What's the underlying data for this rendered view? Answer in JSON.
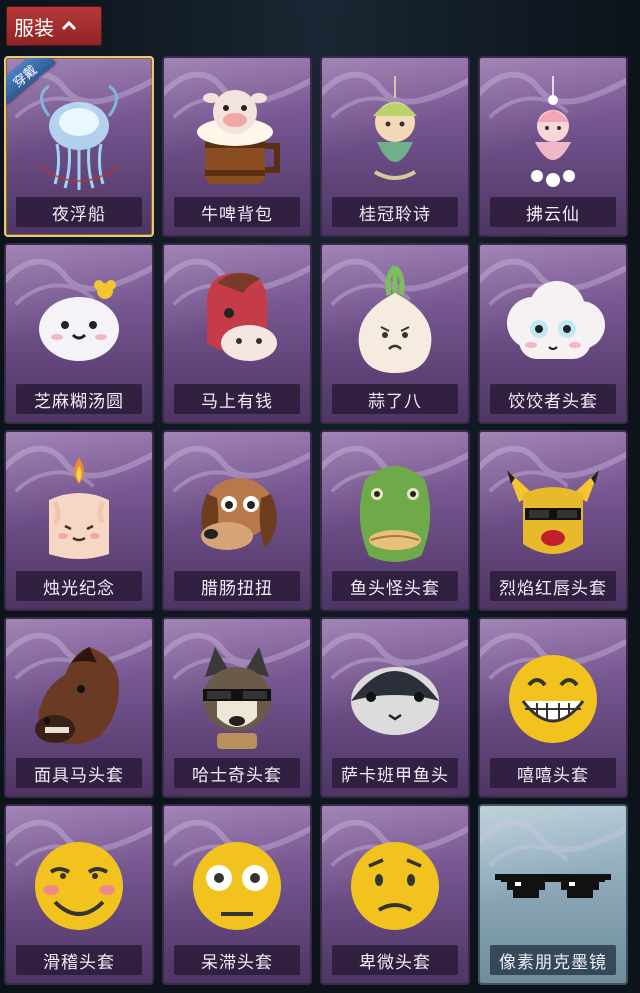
{
  "header": {
    "title": "服装",
    "icon": "chevron-up-icon"
  },
  "equipped_badge": "穿戴",
  "items": [
    {
      "name": "夜浮船",
      "theme": "purple",
      "equipped": true,
      "art": "jellyfish"
    },
    {
      "name": "牛啤背包",
      "theme": "purple",
      "equipped": false,
      "art": "cow-barrel"
    },
    {
      "name": "桂冠聆诗",
      "theme": "purple",
      "equipped": false,
      "art": "laurel-charm"
    },
    {
      "name": "拂云仙",
      "theme": "purple",
      "equipped": false,
      "art": "cloud-fairy-charm"
    },
    {
      "name": "芝麻糊汤圆",
      "theme": "purple",
      "equipped": false,
      "art": "dumpling"
    },
    {
      "name": "马上有钱",
      "theme": "purple",
      "equipped": false,
      "art": "red-horse"
    },
    {
      "name": "蒜了八",
      "theme": "purple",
      "equipped": false,
      "art": "garlic"
    },
    {
      "name": "饺饺者头套",
      "theme": "purple",
      "equipped": false,
      "art": "cloud-head"
    },
    {
      "name": "烛光纪念",
      "theme": "purple",
      "equipped": false,
      "art": "candle"
    },
    {
      "name": "腊肠扭扭",
      "theme": "purple",
      "equipped": false,
      "art": "dachshund"
    },
    {
      "name": "鱼头怪头套",
      "theme": "purple",
      "equipped": false,
      "art": "fish-head"
    },
    {
      "name": "烈焰红唇头套",
      "theme": "purple",
      "equipped": false,
      "art": "yellow-mouse"
    },
    {
      "name": "面具马头套",
      "theme": "purple",
      "equipped": false,
      "art": "horse-mask"
    },
    {
      "name": "哈士奇头套",
      "theme": "purple",
      "equipped": false,
      "art": "husky"
    },
    {
      "name": "萨卡班甲鱼头",
      "theme": "purple",
      "equipped": false,
      "art": "sacabambaspis"
    },
    {
      "name": "嘻嘻头套",
      "theme": "purple",
      "equipped": false,
      "art": "grin-emoji"
    },
    {
      "name": "滑稽头套",
      "theme": "purple",
      "equipped": false,
      "art": "smirk-emoji"
    },
    {
      "name": "呆滞头套",
      "theme": "purple",
      "equipped": false,
      "art": "stare-emoji"
    },
    {
      "name": "卑微头套",
      "theme": "purple",
      "equipped": false,
      "art": "humble-emoji"
    },
    {
      "name": "像素朋克墨镜",
      "theme": "blue",
      "equipped": false,
      "art": "pixel-glasses"
    }
  ]
}
